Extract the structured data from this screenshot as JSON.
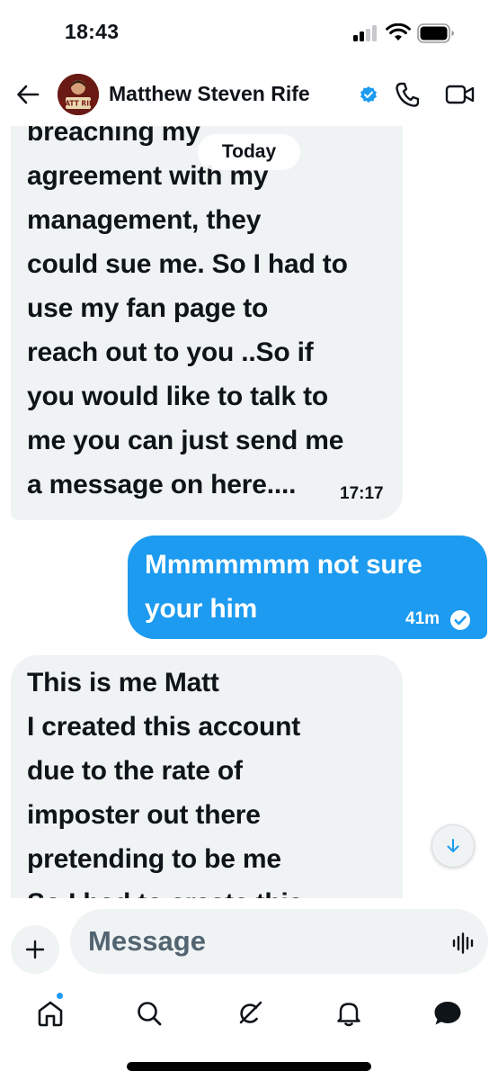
{
  "status_bar": {
    "time": "18:43",
    "icons": [
      "cellular-signal-icon",
      "wifi-icon",
      "battery-icon"
    ]
  },
  "header": {
    "back_icon": "arrow-left-icon",
    "avatar_text": "MATT RIFE",
    "contact_name": "Matthew Steven Rife",
    "verified_icon": "verified-badge-icon",
    "call_icon": "phone-icon",
    "video_icon": "video-camera-icon"
  },
  "date_separator": "Today",
  "messages": [
    {
      "direction": "incoming",
      "text": "breaching my\nagreement with my\nmanagement, they\ncould sue me. So I had to\nuse my fan page to\nreach out to you ..So if\nyou would like to talk to\nme you can just send me\na message on here....",
      "time": "17:17"
    },
    {
      "direction": "outgoing",
      "text": "Mmmmmmm not sure\nyour him",
      "time": "41m",
      "status_icon": "read-check-icon"
    },
    {
      "direction": "incoming",
      "text": "This is me Matt\nI created this account\ndue to the rate of\nimposter out there\npretending to be me\nSo I had to create this",
      "time": ""
    }
  ],
  "composer": {
    "add_icon": "plus-icon",
    "placeholder": "Message",
    "voice_icon": "voice-waveform-icon"
  },
  "tab_bar": {
    "tabs": [
      {
        "name": "home",
        "icon": "home-icon",
        "has_notification": true
      },
      {
        "name": "search",
        "icon": "search-icon"
      },
      {
        "name": "grok",
        "icon": "grok-icon"
      },
      {
        "name": "notifications",
        "icon": "bell-icon"
      },
      {
        "name": "messages",
        "icon": "chat-bubble-icon",
        "active": true
      }
    ]
  },
  "colors": {
    "accent": "#1d9bf0",
    "incoming_bubble": "#eff3f4",
    "text": "#0f1419",
    "secondary_text": "#536471"
  }
}
